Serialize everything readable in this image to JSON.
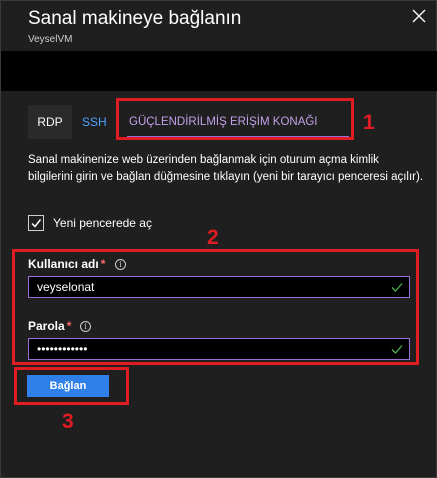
{
  "header": {
    "title": "Sanal makineye bağlanın",
    "subtitle": "VeyselVM"
  },
  "tabs": [
    {
      "label": "RDP"
    },
    {
      "label": "SSH"
    },
    {
      "label": "GÜÇLENDİRİLMİŞ ERİŞİM KONAĞI"
    }
  ],
  "description": "Sanal makinenize web üzerinden bağlanmak için oturum açma kimlik bilgilerini girin ve bağlan düğmesine tıklayın (yeni bir tarayıcı penceresi açılır).",
  "checkbox": {
    "label": "Yeni pencerede aç"
  },
  "username": {
    "label": "Kullanıcı adı",
    "required": "*",
    "value": "veyselonat"
  },
  "password": {
    "label": "Parola",
    "required": "*",
    "value": "••••••••••••"
  },
  "connect_button": {
    "label": "Bağlan"
  },
  "annotations": {
    "n1": "1",
    "n2": "2",
    "n3": "3"
  },
  "colors": {
    "accent": "#9b6fd6",
    "primary": "#2f7fe8",
    "annotation": "#e01c23"
  }
}
